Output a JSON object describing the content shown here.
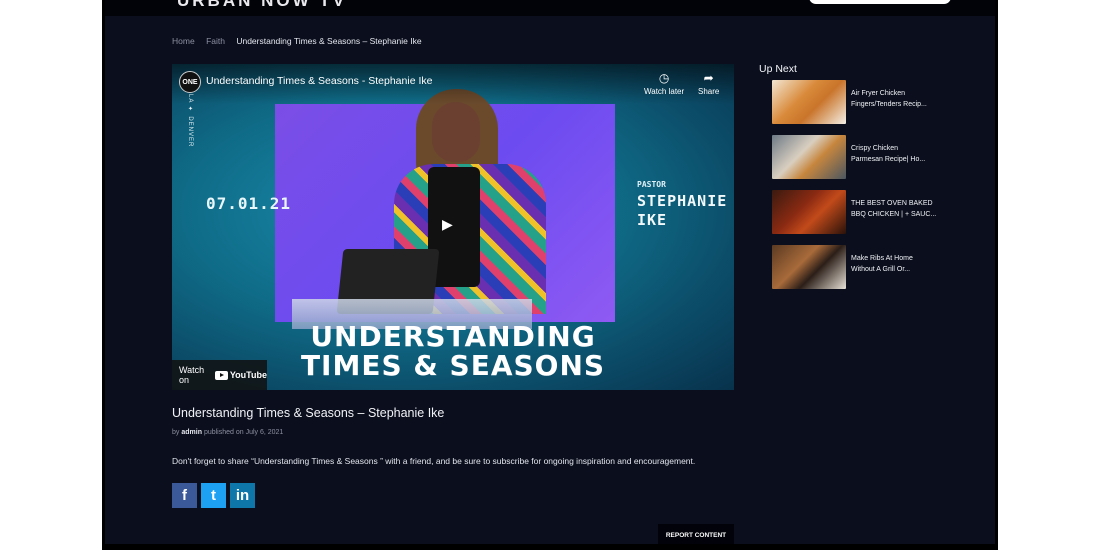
{
  "site": {
    "logo": "URBAN NOW TV"
  },
  "breadcrumb": {
    "home": "Home",
    "category": "Faith",
    "current": "Understanding Times & Seasons – Stephanie Ike"
  },
  "video": {
    "channel_logo": "ONE",
    "title": "Understanding Times & Seasons - Stephanie Ike",
    "watch_later": "Watch later",
    "share": "Share",
    "side_brand": "LA ✦ DENVER",
    "date": "07.01.21",
    "pastor_label": "PASTOR",
    "speaker_line1": "STEPHANIE",
    "speaker_line2": "IKE",
    "big_title_line1": "UNDERSTANDING",
    "big_title_line2": "TIMES & SEASONS",
    "watch_on": "Watch on",
    "youtube": "YouTube"
  },
  "post": {
    "title": "Understanding Times & Seasons – Stephanie Ike",
    "by": "by",
    "author": "admin",
    "published": "published on July 6, 2021",
    "description": "Don't forget to share “Understanding Times & Seasons ” with a friend, and be sure to subscribe for ongoing inspiration and encouragement.",
    "report": "REPORT CONTENT"
  },
  "social": {
    "facebook": "f",
    "twitter": "t",
    "linkedin": "in"
  },
  "up_next": {
    "heading": "Up Next",
    "items": [
      {
        "line1": "Air Fryer Chicken",
        "line2": "Fingers/Tenders Recip..."
      },
      {
        "line1": "Crispy Chicken",
        "line2": "Parmesan Recipe| Ho..."
      },
      {
        "line1": "THE BEST OVEN BAKED",
        "line2": "BBQ CHICKEN | + SAUC..."
      },
      {
        "line1": "Make Ribs At Home",
        "line2": "Without A Grill Or..."
      }
    ]
  },
  "colors": {
    "page_bg": "#0b0f1d",
    "facebook": "#3b5998",
    "twitter": "#1da1f2",
    "linkedin": "#0e76a8"
  }
}
